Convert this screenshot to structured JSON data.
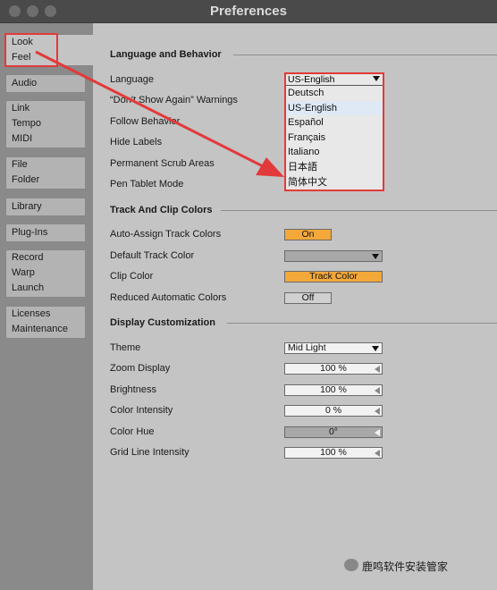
{
  "window": {
    "title": "Preferences"
  },
  "sidebar": {
    "tabs": [
      {
        "lines": [
          "Look",
          "Feel"
        ]
      },
      {
        "lines": [
          "Audio"
        ]
      },
      {
        "lines": [
          "Link",
          "Tempo",
          "MIDI"
        ]
      },
      {
        "lines": [
          "File",
          "Folder"
        ]
      },
      {
        "lines": [
          "Library"
        ]
      },
      {
        "lines": [
          "Plug-Ins"
        ]
      },
      {
        "lines": [
          "Record",
          "Warp",
          "Launch"
        ]
      },
      {
        "lines": [
          "Licenses",
          "Maintenance"
        ]
      }
    ]
  },
  "language_behavior": {
    "heading": "Language and Behavior",
    "language_label": "Language",
    "dont_show_label": "“Don't Show Again” Warnings",
    "follow_label": "Follow Behavior",
    "hide_labels_label": "Hide Labels",
    "scrub_label": "Permanent Scrub Areas",
    "pen_label": "Pen Tablet Mode"
  },
  "language_dropdown": {
    "selected": "US-English",
    "options": [
      "Deutsch",
      "US-English",
      "Español",
      "Français",
      "Italiano",
      "日本語",
      "简体中文"
    ]
  },
  "track_clip": {
    "heading": "Track And Clip Colors",
    "auto_assign_label": "Auto-Assign Track Colors",
    "auto_assign_value": "On",
    "default_color_label": "Default Track Color",
    "clip_color_label": "Clip Color",
    "clip_color_value": "Track Color",
    "reduced_label": "Reduced Automatic Colors",
    "reduced_value": "Off"
  },
  "display": {
    "heading": "Display Customization",
    "theme_label": "Theme",
    "theme_value": "Mid Light",
    "zoom_label": "Zoom Display",
    "zoom_value": "100 %",
    "brightness_label": "Brightness",
    "brightness_value": "100 %",
    "intensity_label": "Color Intensity",
    "intensity_value": "0 %",
    "hue_label": "Color Hue",
    "hue_value": "0°",
    "grid_label": "Grid Line Intensity",
    "grid_value": "100 %"
  },
  "watermark": {
    "text": "鹿鸣软件安装管家"
  }
}
